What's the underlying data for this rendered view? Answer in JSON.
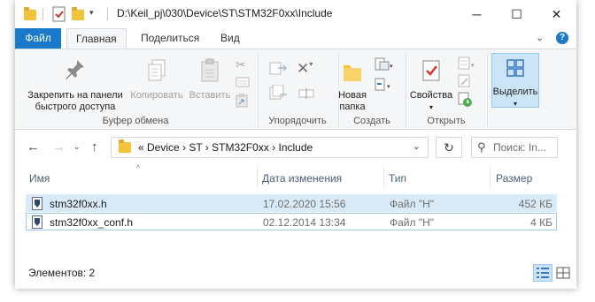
{
  "titlebar": {
    "path": "D:\\Keil_pj\\030\\Device\\ST\\STM32F0xx\\Include",
    "min_glyph": "─",
    "max_glyph": "☐",
    "close_glyph": "✕"
  },
  "ribbon_tabs": {
    "file": "Файл",
    "home": "Главная",
    "share": "Поделиться",
    "view": "Вид"
  },
  "ribbon": {
    "pin_label": "Закрепить на панели быстрого доступа",
    "copy_label": "Копировать",
    "paste_label": "Вставить",
    "clipboard_group": "Буфер обмена",
    "organize_group": "Упорядочить",
    "new_folder_label": "Новая папка",
    "create_group": "Создать",
    "properties_label": "Свойства",
    "open_group": "Открыть",
    "select_label": "Выделить"
  },
  "address": {
    "crumbs": "«  Device  ›  ST  ›  STM32F0xx  ›  Include",
    "search_placeholder": "Поиск: In..."
  },
  "columns": {
    "name": "Имя",
    "date": "Дата изменения",
    "type": "Тип",
    "size": "Размер"
  },
  "files": [
    {
      "name": "stm32f0xx.h",
      "date": "17.02.2020 15:56",
      "type": "Файл \"H\"",
      "size": "452 КБ"
    },
    {
      "name": "stm32f0xx_conf.h",
      "date": "02.12.2014 13:34",
      "type": "Файл \"H\"",
      "size": "4 КБ"
    }
  ],
  "status": {
    "items_count": "Элементов: 2"
  },
  "colors": {
    "accent": "#1979ca",
    "selection": "#d9ebf9",
    "folder": "#f3c33b"
  }
}
